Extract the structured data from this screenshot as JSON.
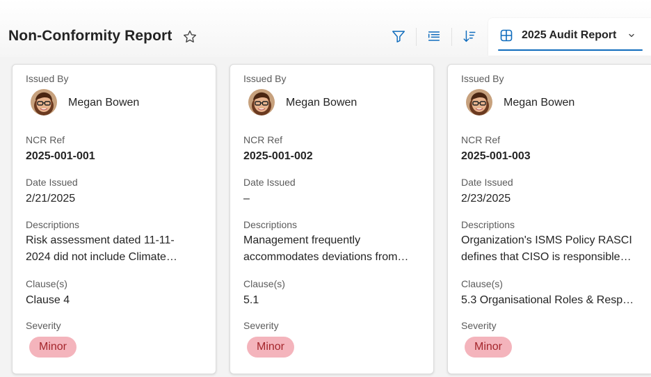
{
  "page": {
    "title": "Non-Conformity Report",
    "view_label": "2025 Audit Report"
  },
  "icons": {
    "favorite": "star-outline-icon",
    "filter": "filter-icon",
    "group": "list-group-icon",
    "sort": "sort-descending-icon",
    "view": "grid-view-icon",
    "view_dropdown": "chevron-down-icon"
  },
  "colors": {
    "accent": "#0f6cbd",
    "badge_bg": "#f4b4bc",
    "badge_text": "#a4262c"
  },
  "fields": {
    "issued_by": "Issued By",
    "ncr_ref": "NCR Ref",
    "date_issued": "Date Issued",
    "descriptions": "Descriptions",
    "clauses": "Clause(s)",
    "severity": "Severity"
  },
  "cards": [
    {
      "issued_by": "Megan Bowen",
      "ncr_ref": "2025-001-001",
      "date_issued": "2/21/2025",
      "description_line1": "Risk assessment dated 11-11-",
      "description_line2": "2024 did not include Climate…",
      "clause": "Clause 4",
      "severity": "Minor"
    },
    {
      "issued_by": "Megan Bowen",
      "ncr_ref": "2025-001-002",
      "date_issued": "–",
      "description_line1": "Management frequently",
      "description_line2": "accommodates deviations from…",
      "clause": "5.1",
      "severity": "Minor"
    },
    {
      "issued_by": "Megan Bowen",
      "ncr_ref": "2025-001-003",
      "date_issued": "2/23/2025",
      "description_line1": "Organization's ISMS Policy RASCI",
      "description_line2": "defines that CISO is responsible…",
      "clause": "5.3 Organisational Roles & Resp…",
      "severity": "Minor"
    }
  ]
}
